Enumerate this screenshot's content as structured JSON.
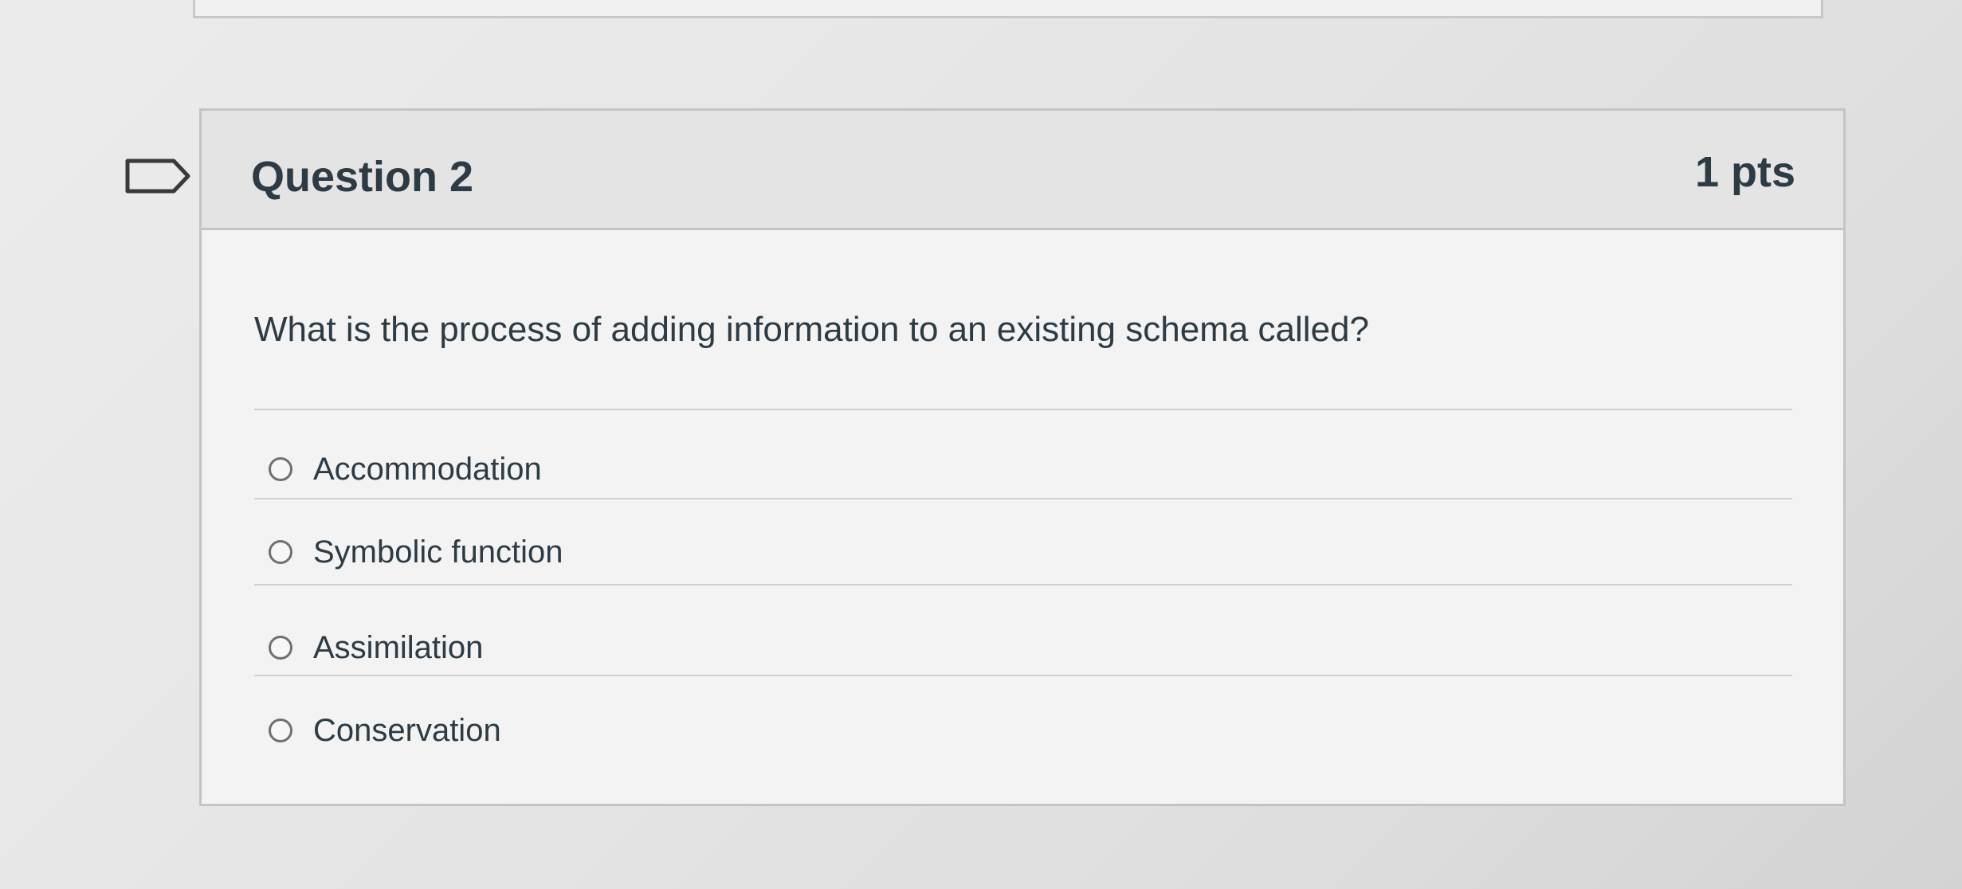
{
  "question": {
    "title": "Question 2",
    "points": "1 pts",
    "text": "What is the process of adding information to an existing schema called?",
    "flag_icon": "flag-bookmark-icon"
  },
  "answers": [
    {
      "label": "Accommodation",
      "selected": false
    },
    {
      "label": "Symbolic function",
      "selected": false
    },
    {
      "label": "Assimilation",
      "selected": false
    },
    {
      "label": "Conservation",
      "selected": false
    }
  ],
  "colors": {
    "text": "#2d3b45",
    "header_bg": "#e4e4e4",
    "card_bg": "#f3f3f3",
    "border": "#c4c4c4"
  }
}
